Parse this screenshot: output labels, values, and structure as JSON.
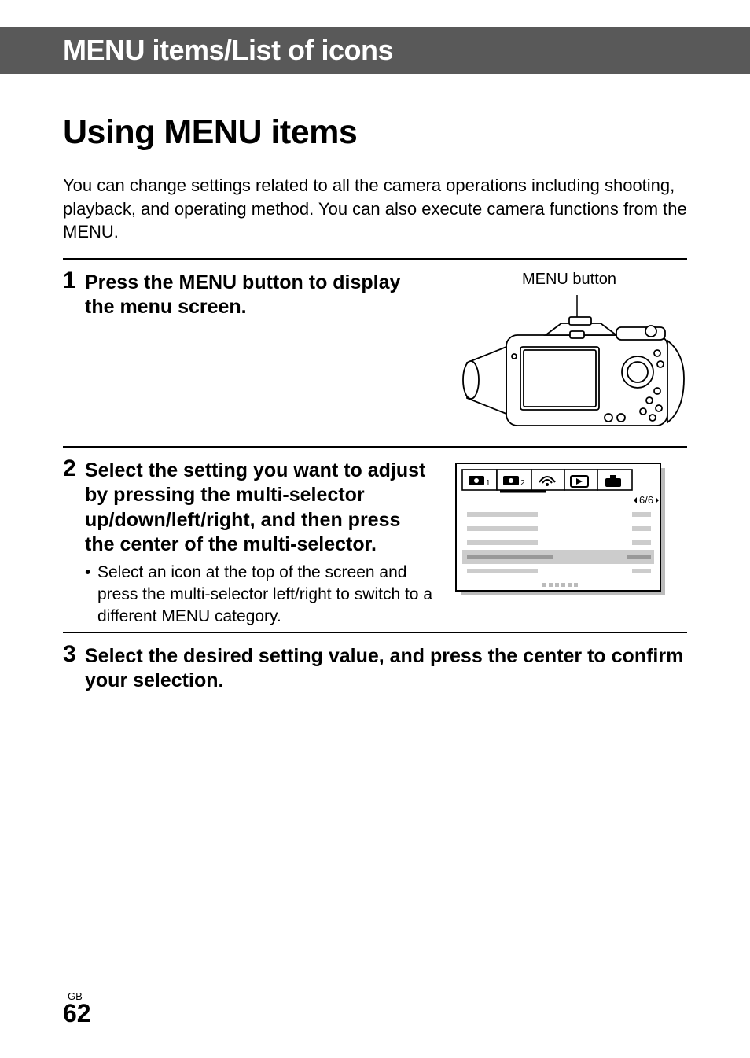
{
  "header": {
    "title": "MENU items/List of icons"
  },
  "section": {
    "title": "Using MENU items"
  },
  "intro": "You can change settings related to all the camera operations including shooting, playback, and operating method. You can also execute camera functions from the MENU.",
  "steps": {
    "s1": {
      "num": "1",
      "heading": "Press the MENU button to display the menu screen.",
      "figure_caption": "MENU button"
    },
    "s2": {
      "num": "2",
      "heading": "Select the setting you want to adjust by pressing the multi-selector up/down/left/right, and then press the center of the multi-selector.",
      "bullet": "Select an icon at the top of the screen and press the multi-selector left/right to switch to a different MENU category.",
      "menu_page_indicator": "6/6"
    },
    "s3": {
      "num": "3",
      "heading": "Select the desired setting value, and press the center to confirm your selection."
    }
  },
  "footer": {
    "lang": "GB",
    "page": "62"
  }
}
